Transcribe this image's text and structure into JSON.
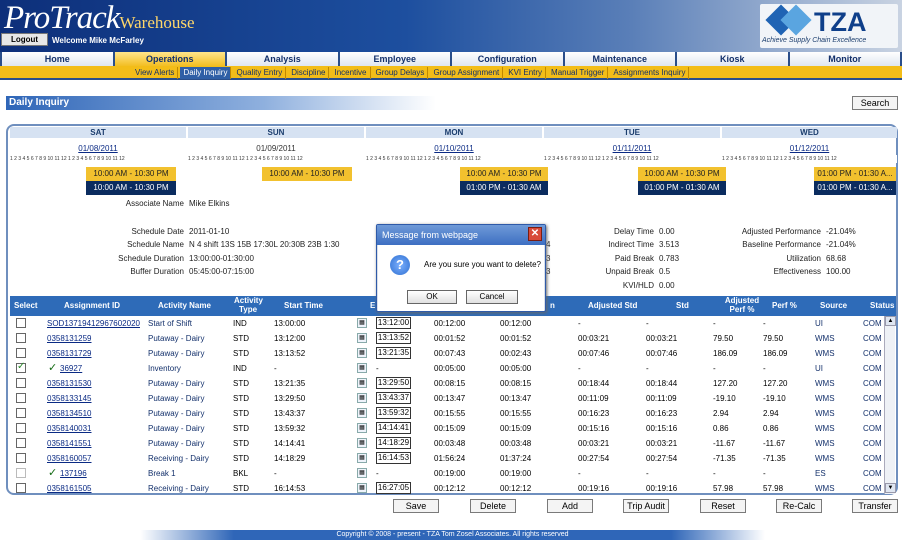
{
  "header": {
    "logo_main": "ProTrack",
    "logo_sub": "Warehouse",
    "logout": "Logout",
    "welcome": "Welcome Mike McFarley",
    "brand": "TZA",
    "brand_tagline": "Achieve Supply Chain Excellence"
  },
  "nav": [
    "Home",
    "Operations",
    "Analysis",
    "Employee",
    "Configuration",
    "Maintenance",
    "Kiosk",
    "Monitor"
  ],
  "subnav": [
    "View Alerts",
    "Daily Inquiry",
    "Quality Entry",
    "Discipline",
    "Incentive",
    "Group Delays",
    "Group Assignment",
    "KVI Entry",
    "Manual Trigger",
    "Assignments Inquiry"
  ],
  "page": {
    "title": "Daily Inquiry",
    "search": "Search"
  },
  "days": [
    {
      "name": "SAT",
      "date": "01/08/2011",
      "shift": "10:00 AM - 10:30 PM",
      "actual": "10:00 AM - 10:30 PM"
    },
    {
      "name": "SUN",
      "date": "01/09/2011",
      "shift": "10:00 AM - 10:30 PM",
      "actual": ""
    },
    {
      "name": "MON",
      "date": "01/10/2011",
      "shift": "10:00 AM - 10:30 PM",
      "actual": "01:00 PM - 01:30 AM"
    },
    {
      "name": "TUE",
      "date": "01/11/2011",
      "shift": "10:00 AM - 10:30 PM",
      "actual": "01:00 PM - 01:30 AM"
    },
    {
      "name": "WED",
      "date": "01/12/2011",
      "shift": "01:00 PM - 01:30 A...",
      "actual": "01:00 PM - 01:30 A..."
    }
  ],
  "ticks": "1 2 3 4 5 6 7 8 9 10 11 12 1 2 3 4 5 6 7 8 9 10 11 12",
  "info": {
    "associate_label": "Associate Name",
    "associate": "Mike Elkins",
    "sched_date_label": "Schedule Date",
    "sched_date": "2011-01-10",
    "sched_name_label": "Schedule Name",
    "sched_name": "N 4 shift 13S 15B 17:30L 20:30B 23B 1:30",
    "sched_dur_label": "Schedule Duration",
    "sched_dur": "13:00:00-01:30:00",
    "buffer_label": "Buffer Duration",
    "buffer": "05:45:00-07:15:00",
    "delay_label": "Delay Time",
    "delay": "0.00",
    "indirect_label": "Indirect Time",
    "indirect": "3.513",
    "paid_label": "Paid Break",
    "paid": "0.783",
    "unpaid_label": "Unpaid Break",
    "unpaid": "0.5",
    "kvi_label": "KVI/HLD",
    "kvi": "0.00",
    "adj_perf_label": "Adjusted Performance",
    "adj_perf": "-21.04%",
    "base_perf_label": "Baseline Performance",
    "base_perf": "-21.04%",
    "util_label": "Utilization",
    "util": "68.68",
    "eff_label": "Effectiveness",
    "eff": "100.00",
    "partial_3a": "3",
    "partial_3b": "3",
    "partial_4": "4"
  },
  "table": {
    "headers": {
      "select": "Select",
      "assignment": "Assignment ID",
      "activity": "Activity Name",
      "type": "Activity Type",
      "start": "Start Time",
      "end": "E",
      "n": "n",
      "adj_std": "Adjusted Std",
      "std": "Std",
      "adj_perf": "Adjusted Perf %",
      "perf": "Perf %",
      "source": "Source",
      "status": "Status"
    },
    "rows": [
      {
        "check": "off",
        "id": "SOD13719412967602020",
        "activity": "Start of Shift",
        "type": "IND",
        "start": "13:00:00",
        "end": "13:12:00",
        "c1": "00:12:00",
        "c2": "00:12:00",
        "adj_std": "-",
        "std": "-",
        "adj_perf": "-",
        "perf": "-",
        "source": "UI",
        "status": "COM"
      },
      {
        "check": "off",
        "id": "0358131259",
        "activity": "Putaway - Dairy",
        "type": "STD",
        "start": "13:12:00",
        "end": "13:13:52",
        "c1": "00:01:52",
        "c2": "00:01:52",
        "adj_std": "00:03:21",
        "std": "00:03:21",
        "adj_perf": "79.50",
        "perf": "79.50",
        "source": "WMS",
        "status": "COM"
      },
      {
        "check": "off",
        "id": "0358131729",
        "activity": "Putaway - Dairy",
        "type": "STD",
        "start": "13:13:52",
        "end": "13:21:35",
        "c1": "00:07:43",
        "c2": "00:02:43",
        "adj_std": "00:07:46",
        "std": "00:07:46",
        "adj_perf": "186.09",
        "perf": "186.09",
        "source": "WMS",
        "status": "COM"
      },
      {
        "check": "on",
        "id": "36927",
        "activity": "Inventory",
        "type": "IND",
        "start": "-",
        "end": "",
        "c1": "00:05:00",
        "c2": "00:05:00",
        "adj_std": "-",
        "std": "-",
        "adj_perf": "-",
        "perf": "-",
        "source": "UI",
        "status": "COM"
      },
      {
        "check": "off",
        "id": "0358131530",
        "activity": "Putaway - Dairy",
        "type": "STD",
        "start": "13:21:35",
        "end": "13:29:50",
        "c1": "00:08:15",
        "c2": "00:08:15",
        "adj_std": "00:18:44",
        "std": "00:18:44",
        "adj_perf": "127.20",
        "perf": "127.20",
        "source": "WMS",
        "status": "COM"
      },
      {
        "check": "off",
        "id": "0358133145",
        "activity": "Putaway - Dairy",
        "type": "STD",
        "start": "13:29:50",
        "end": "13:43:37",
        "c1": "00:13:47",
        "c2": "00:13:47",
        "adj_std": "00:11:09",
        "std": "00:11:09",
        "adj_perf": "-19.10",
        "perf": "-19.10",
        "source": "WMS",
        "status": "COM"
      },
      {
        "check": "off",
        "id": "0358134510",
        "activity": "Putaway - Dairy",
        "type": "STD",
        "start": "13:43:37",
        "end": "13:59:32",
        "c1": "00:15:55",
        "c2": "00:15:55",
        "adj_std": "00:16:23",
        "std": "00:16:23",
        "adj_perf": "2.94",
        "perf": "2.94",
        "source": "WMS",
        "status": "COM"
      },
      {
        "check": "off",
        "id": "0358140031",
        "activity": "Putaway - Dairy",
        "type": "STD",
        "start": "13:59:32",
        "end": "14:14:41",
        "c1": "00:15:09",
        "c2": "00:15:09",
        "adj_std": "00:15:16",
        "std": "00:15:16",
        "adj_perf": "0.86",
        "perf": "0.86",
        "source": "WMS",
        "status": "COM"
      },
      {
        "check": "off",
        "id": "0358141551",
        "activity": "Putaway - Dairy",
        "type": "STD",
        "start": "14:14:41",
        "end": "14:18:29",
        "c1": "00:03:48",
        "c2": "00:03:48",
        "adj_std": "00:03:21",
        "std": "00:03:21",
        "adj_perf": "-11.67",
        "perf": "-11.67",
        "source": "WMS",
        "status": "COM"
      },
      {
        "check": "off",
        "id": "0358160057",
        "activity": "Receiving - Dairy",
        "type": "STD",
        "start": "14:18:29",
        "end": "16:14:53",
        "c1": "01:56:24",
        "c2": "01:37:24",
        "adj_std": "00:27:54",
        "std": "00:27:54",
        "adj_perf": "-71.35",
        "perf": "-71.35",
        "source": "WMS",
        "status": "COM"
      },
      {
        "check": "dis",
        "id": "137196",
        "activity": "Break 1",
        "type": "BKL",
        "start": "-",
        "end": "",
        "c1": "00:19:00",
        "c2": "00:19:00",
        "adj_std": "-",
        "std": "-",
        "adj_perf": "-",
        "perf": "-",
        "source": "ES",
        "status": "COM"
      },
      {
        "check": "off",
        "id": "0358161505",
        "activity": "Receiving - Dairy",
        "type": "STD",
        "start": "16:14:53",
        "end": "16:27:05",
        "c1": "00:12:12",
        "c2": "00:12:12",
        "adj_std": "00:19:16",
        "std": "00:19:16",
        "adj_perf": "57.98",
        "perf": "57.98",
        "source": "WMS",
        "status": "COM"
      }
    ]
  },
  "actions": [
    "Save",
    "Delete",
    "Add",
    "Trip Audit",
    "Reset",
    "Re-Calc",
    "Transfer"
  ],
  "dialog": {
    "title": "Message from webpage",
    "message": "Are you sure you want to delete?",
    "ok": "OK",
    "cancel": "Cancel"
  },
  "footer": "Copyright © 2008 - present - TZA Tom Zosel Associates. All rights reserved"
}
